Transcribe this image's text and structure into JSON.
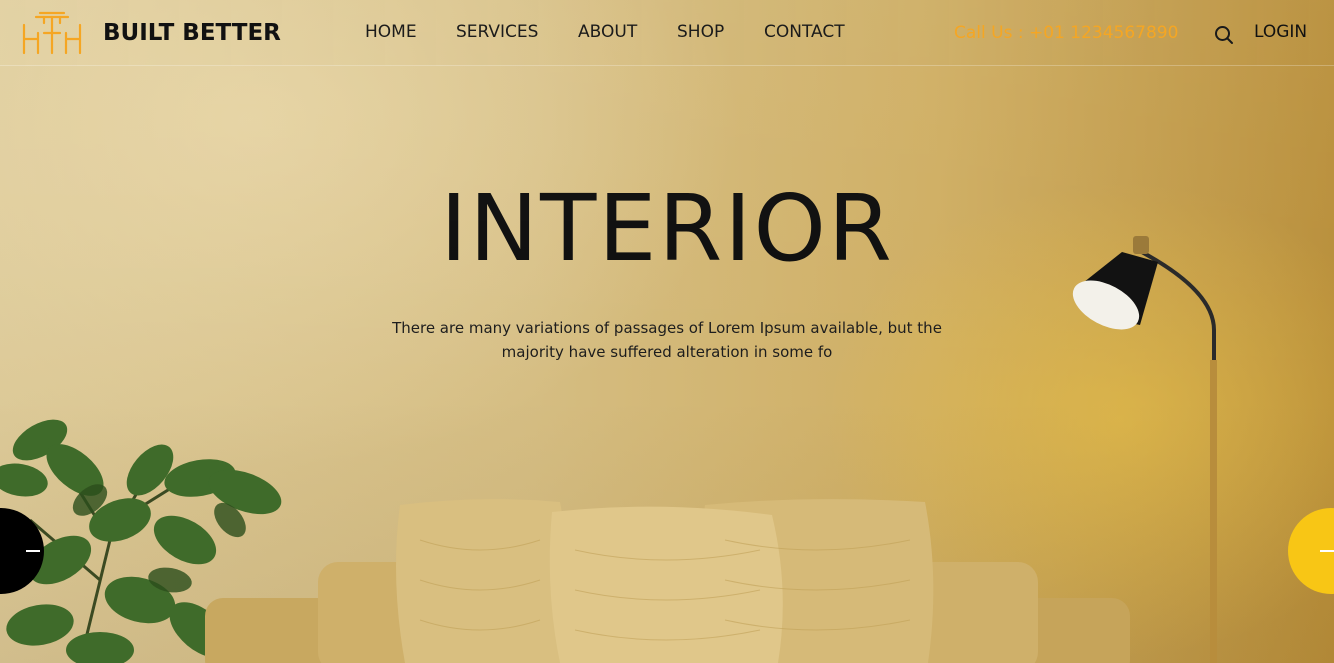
{
  "brand": {
    "name": "BUILT BETTER",
    "logo_icon": "furniture-table-chairs-icon",
    "accent_color": "#f5a623"
  },
  "nav": {
    "items": [
      {
        "label": "HOME"
      },
      {
        "label": "SERVICES"
      },
      {
        "label": "ABOUT"
      },
      {
        "label": "SHOP"
      },
      {
        "label": "CONTACT"
      }
    ]
  },
  "header": {
    "call_us": "Call Us : +01 1234567890",
    "search_icon": "search-icon",
    "login_label": "LOGIN"
  },
  "hero": {
    "title": "INTERIOR",
    "subtitle": "There are many variations of passages of Lorem Ipsum available, but the majority have suffered alteration in some fo"
  },
  "carousel": {
    "prev_icon": "arrow-left-icon",
    "next_icon": "arrow-right-icon",
    "prev_color": "#000000",
    "next_color": "#f8c615"
  }
}
